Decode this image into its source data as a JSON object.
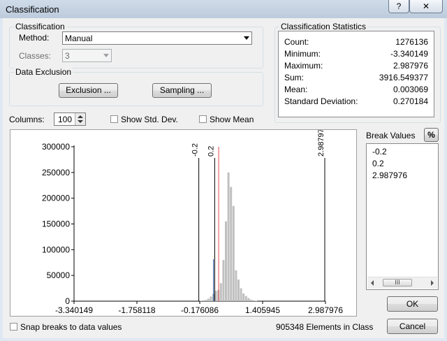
{
  "window": {
    "title": "Classification",
    "help_glyph": "?",
    "close_glyph": "✕"
  },
  "classification_group": {
    "legend": "Classification",
    "method_label": "Method:",
    "method_value": "Manual",
    "classes_label": "Classes:",
    "classes_value": "3"
  },
  "data_exclusion_group": {
    "legend": "Data Exclusion",
    "exclusion_button": "Exclusion ...",
    "sampling_button": "Sampling ..."
  },
  "statistics": {
    "legend": "Classification Statistics",
    "rows": [
      {
        "key": "Count:",
        "value": "1276136"
      },
      {
        "key": "Minimum:",
        "value": "-3.340149"
      },
      {
        "key": "Maximum:",
        "value": "2.987976"
      },
      {
        "key": "Sum:",
        "value": "3916.549377"
      },
      {
        "key": "Mean:",
        "value": "0.003069"
      },
      {
        "key": "Standard Deviation:",
        "value": "0.270184"
      }
    ]
  },
  "columns": {
    "label": "Columns:",
    "value": "100"
  },
  "show_std_dev": {
    "label": "Show Std. Dev.",
    "checked": false
  },
  "show_mean": {
    "label": "Show Mean",
    "checked": false
  },
  "break_values": {
    "label": "Break Values",
    "percent_button": "%",
    "items": [
      "-0.2",
      "0.2",
      "2.987976"
    ],
    "scroll_thumb_glyph": "III"
  },
  "buttons": {
    "ok": "OK",
    "cancel": "Cancel"
  },
  "snap": {
    "label": "Snap breaks to data values",
    "checked": false
  },
  "elements_in_class": "905348 Elements in Class",
  "chart_data": {
    "type": "bar",
    "x_tick_labels": [
      "-3.340149",
      "-1.758118",
      "-0.176086",
      "1.405945",
      "2.987976"
    ],
    "x_ticks": [
      -3.340149,
      -1.758118,
      -0.176086,
      1.405945,
      2.987976
    ],
    "xlim": [
      -3.340149,
      2.987976
    ],
    "y_tick_labels": [
      "0",
      "50000",
      "100000",
      "150000",
      "200000",
      "250000",
      "300000"
    ],
    "y_ticks": [
      0,
      50000,
      100000,
      150000,
      200000,
      250000,
      300000
    ],
    "ylim": [
      0,
      300000
    ],
    "bin_count": 100,
    "bin_start": -3.340149,
    "bin_width": 0.0632812,
    "bins": [
      {
        "i": 50,
        "v": 1000
      },
      {
        "i": 51,
        "v": 1500
      },
      {
        "i": 52,
        "v": 2500
      },
      {
        "i": 53,
        "v": 5000
      },
      {
        "i": 54,
        "v": 9000
      },
      {
        "i": 55,
        "v": 14000
      },
      {
        "i": 56,
        "v": 20000
      },
      {
        "i": 57,
        "v": 22000
      },
      {
        "i": 58,
        "v": 35000
      },
      {
        "i": 59,
        "v": 80000
      },
      {
        "i": 60,
        "v": 155000
      },
      {
        "i": 61,
        "v": 250000
      },
      {
        "i": 62,
        "v": 222000
      },
      {
        "i": 63,
        "v": 185000
      },
      {
        "i": 64,
        "v": 60000
      },
      {
        "i": 65,
        "v": 42000
      },
      {
        "i": 66,
        "v": 25000
      },
      {
        "i": 67,
        "v": 15000
      },
      {
        "i": 68,
        "v": 10000
      },
      {
        "i": 69,
        "v": 6000
      },
      {
        "i": 70,
        "v": 3000
      },
      {
        "i": 71,
        "v": 1500
      },
      {
        "i": 72,
        "v": 800
      }
    ],
    "bar_color": "#c0c0c0",
    "breaks": [
      {
        "value": -0.2,
        "label": "-0.2",
        "color": "#000000"
      },
      {
        "value": 0.2,
        "label": "0.2",
        "color": "#000000"
      },
      {
        "value": 2.987976,
        "label": "2.987976",
        "color": "#000000"
      }
    ],
    "mean_line": {
      "value": 0.3,
      "color": "#e24b4b"
    },
    "selected_line": {
      "value": 0.17,
      "color": "#1f4e9c"
    }
  }
}
